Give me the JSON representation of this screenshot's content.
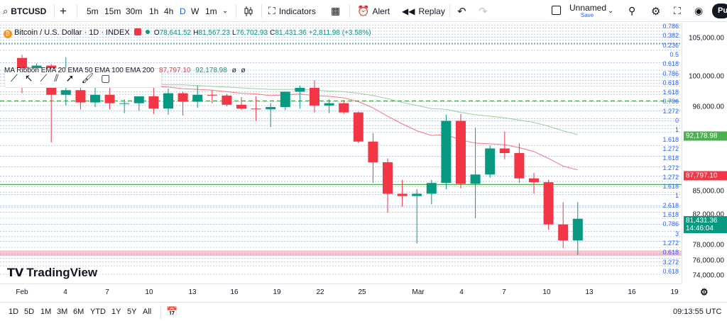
{
  "toolbar": {
    "symbol": "BTCUSD",
    "add_icon": "+",
    "intervals": [
      "5m",
      "15m",
      "30m",
      "1h",
      "4h",
      "D",
      "W",
      "1m"
    ],
    "active_interval": "D",
    "indicators_label": "Indicators",
    "alert_label": "Alert",
    "replay_label": "Replay",
    "layout_name": "Unnamed",
    "layout_status": "Save",
    "publish_label": "Pu"
  },
  "legend": {
    "title": "Bitcoin / U.S. Dollar · 1D · INDEX",
    "o_label": "O",
    "o": "78,641.52",
    "h_label": "H",
    "h": "81,567.23",
    "l_label": "L",
    "l": "76,702.93",
    "c_label": "C",
    "c": "81,431.36",
    "change": "+2,811.98 (+3.58%)",
    "ma_label": "MA Ribbon EMA 20 EMA 50 EMA 100 EMA 200",
    "ma_v1": "87,797.10",
    "ma_v2": "92,178.98",
    "ma_v3": "ø",
    "ma_v4": "ø"
  },
  "watermark": "TradingView",
  "price_axis": {
    "ticks": [
      "105,000.00",
      "100,000.00",
      "96,000.00",
      "85,000.00",
      "82,000.00",
      "78,000.00",
      "76,000.00",
      "74,000.00"
    ],
    "last_price": "81,431.36",
    "countdown": "14:46:04",
    "ema100_tag": "92,178.98",
    "ema50_tag": "87,797.10"
  },
  "fib_labels": [
    "0.786",
    "0.382",
    "0.236",
    "0.5",
    "0.618",
    "0.786",
    "0.618",
    "1.618",
    "0.786",
    "1.272",
    "0",
    "1",
    "1.618",
    "1.272",
    "1.618",
    "1.272",
    "1.272",
    "1.618",
    "1",
    "2.618",
    "1.618",
    "0.786",
    "3",
    "1.272",
    "0.618",
    "3.272",
    "0.618"
  ],
  "time_axis": {
    "labels": [
      "Feb",
      "4",
      "7",
      "10",
      "13",
      "16",
      "19",
      "22",
      "25",
      "Mar",
      "4",
      "7",
      "10",
      "13",
      "16",
      "19"
    ]
  },
  "bottom": {
    "ranges": [
      "1D",
      "5D",
      "1M",
      "3M",
      "6M",
      "YTD",
      "1Y",
      "5Y",
      "All"
    ],
    "clock": "09:13:55 UTC"
  },
  "chart_data": {
    "type": "candlestick",
    "x": [
      "Feb 1",
      "Feb 2",
      "Feb 3",
      "Feb 4",
      "Feb 5",
      "Feb 6",
      "Feb 7",
      "Feb 8",
      "Feb 9",
      "Feb 10",
      "Feb 11",
      "Feb 12",
      "Feb 13",
      "Feb 14",
      "Feb 15",
      "Feb 16",
      "Feb 17",
      "Feb 18",
      "Feb 19",
      "Feb 20",
      "Feb 21",
      "Feb 22",
      "Feb 23",
      "Feb 24",
      "Feb 25",
      "Feb 26",
      "Feb 27",
      "Feb 28",
      "Mar 1",
      "Mar 2",
      "Mar 3",
      "Mar 4",
      "Mar 5",
      "Mar 6",
      "Mar 7",
      "Mar 8",
      "Mar 9",
      "Mar 10",
      "Mar 11"
    ],
    "open": [
      102400,
      100600,
      101400,
      97600,
      98200,
      96600,
      97600,
      96500,
      96500,
      97400,
      95800,
      97800,
      96700,
      97600,
      97500,
      96300,
      95800,
      95700,
      96000,
      98000,
      98500,
      96200,
      96500,
      95300,
      91500,
      88800,
      84700,
      84400,
      84700,
      86100,
      94200,
      86000,
      87200,
      90600,
      90000,
      86700,
      86200,
      80700,
      78600
    ],
    "high": [
      102800,
      101700,
      101600,
      102500,
      99000,
      99200,
      100100,
      97000,
      97300,
      98500,
      98400,
      98000,
      98800,
      98200,
      97700,
      97300,
      97400,
      96500,
      96700,
      98800,
      99500,
      97000,
      96900,
      95400,
      92600,
      89300,
      86500,
      85300,
      86500,
      95000,
      95100,
      93300,
      91000,
      92800,
      91300,
      87400,
      86500,
      83600,
      83600
    ],
    "low": [
      97800,
      99600,
      91400,
      96200,
      95700,
      96000,
      95700,
      95200,
      95500,
      95100,
      95000,
      94900,
      95900,
      96500,
      96100,
      95600,
      94200,
      93400,
      95600,
      95800,
      95300,
      95200,
      95100,
      91300,
      86100,
      82200,
      83000,
      78200,
      83300,
      85300,
      85400,
      81500,
      86800,
      89200,
      86100,
      84700,
      80000,
      77600,
      76700
    ],
    "close": [
      100600,
      101400,
      97600,
      98200,
      96600,
      97600,
      96500,
      96500,
      97400,
      95800,
      97800,
      96700,
      97600,
      97500,
      96300,
      95800,
      95700,
      96000,
      98000,
      98500,
      96200,
      96500,
      95300,
      91500,
      88800,
      84700,
      84400,
      84700,
      86100,
      94200,
      86000,
      87200,
      90600,
      90000,
      86700,
      86200,
      80700,
      78600,
      81431
    ],
    "series": [
      {
        "name": "EMA 20",
        "values": [
          101200,
          101100,
          100600,
          100400,
          100000,
          99800,
          99500,
          99200,
          99000,
          98700,
          98600,
          98400,
          98300,
          98200,
          98000,
          97800,
          97700,
          97500,
          97600,
          97700,
          97500,
          97400,
          97200,
          96700,
          95900,
          94800,
          93800,
          92900,
          92300,
          92400,
          91700,
          91300,
          91200,
          91100,
          90700,
          90200,
          89300,
          88300,
          87800
        ]
      },
      {
        "name": "EMA 50",
        "values": [
          99800,
          99800,
          99700,
          99600,
          99500,
          99400,
          99300,
          99200,
          99100,
          99000,
          98900,
          98900,
          98800,
          98700,
          98600,
          98500,
          98400,
          98300,
          98300,
          98300,
          98200,
          98100,
          98000,
          97800,
          97500,
          97100,
          96600,
          96200,
          95800,
          95700,
          95300,
          95000,
          94800,
          94600,
          94300,
          94000,
          93500,
          92900,
          92400
        ]
      }
    ],
    "ylim": [
      73000,
      107000
    ],
    "fib_levels": [
      106700,
      106300,
      105900,
      105500,
      105100,
      104700,
      104200,
      103400,
      101800,
      100800,
      100300,
      99900,
      99500,
      99100,
      98700,
      98000,
      97600,
      96700,
      96200,
      95500,
      94500,
      94200,
      93600,
      93200,
      92700,
      91000,
      89600,
      88200,
      87000,
      86300,
      85900,
      85600,
      84900,
      84600,
      83100,
      82900,
      82300,
      81500,
      80700,
      79800,
      79100,
      78500,
      77700,
      76800,
      76300,
      75800,
      75300,
      74200
    ],
    "horizontal_lines": [
      {
        "price": 85900,
        "color": "#4caf50",
        "style": "solid"
      },
      {
        "price": 96800,
        "color": "#4caf50",
        "style": "dashed"
      },
      {
        "price": 104300,
        "color": "#4caf50",
        "style": "dotted"
      }
    ],
    "zone": {
      "from": 76600,
      "to": 77300,
      "color": "#f7c6ca"
    }
  },
  "colors": {
    "up": "#089981",
    "down": "#f23645",
    "ema20": "#f7525f",
    "ema50": "#81c784",
    "accent": "#2962ff"
  }
}
